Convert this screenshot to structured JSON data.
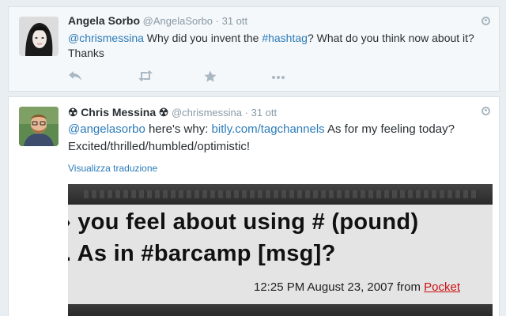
{
  "tweets": [
    {
      "fullname": "Angela Sorbo",
      "handle": "@AngelaSorbo",
      "separator": "·",
      "time": "31 ott",
      "text_parts": {
        "mention": "@chrismessina",
        "t1": " Why did you invent the ",
        "hashtag": "#hashtag",
        "t2": "? What do you think now about it? Thanks"
      },
      "actions": {
        "reply_icon": "reply-icon",
        "retweet_icon": "retweet-icon",
        "favorite_icon": "star-icon",
        "more_icon": "more-icon"
      }
    },
    {
      "badge": "☢",
      "fullname": "Chris Messina",
      "handle": "@chrismessina",
      "separator": "·",
      "time": "31 ott",
      "text_parts": {
        "mention": "@angelasorbo",
        "t1": " here's why: ",
        "link": "bitly.com/tagchannels",
        "t2": " As for my feeling today? Excited/thrilled/humbled/optimistic!"
      },
      "translate_label": "Visualizza traduzione",
      "media": {
        "line1": "› you feel about using # (pound)",
        "line2": ". As in #barcamp [msg]?",
        "meta": "12:25 PM August 23, 2007 from ",
        "source": "Pocket"
      }
    }
  ],
  "colors": {
    "link": "#2b7bb9",
    "background": "#e9eef2",
    "muted": "#8899a6"
  }
}
